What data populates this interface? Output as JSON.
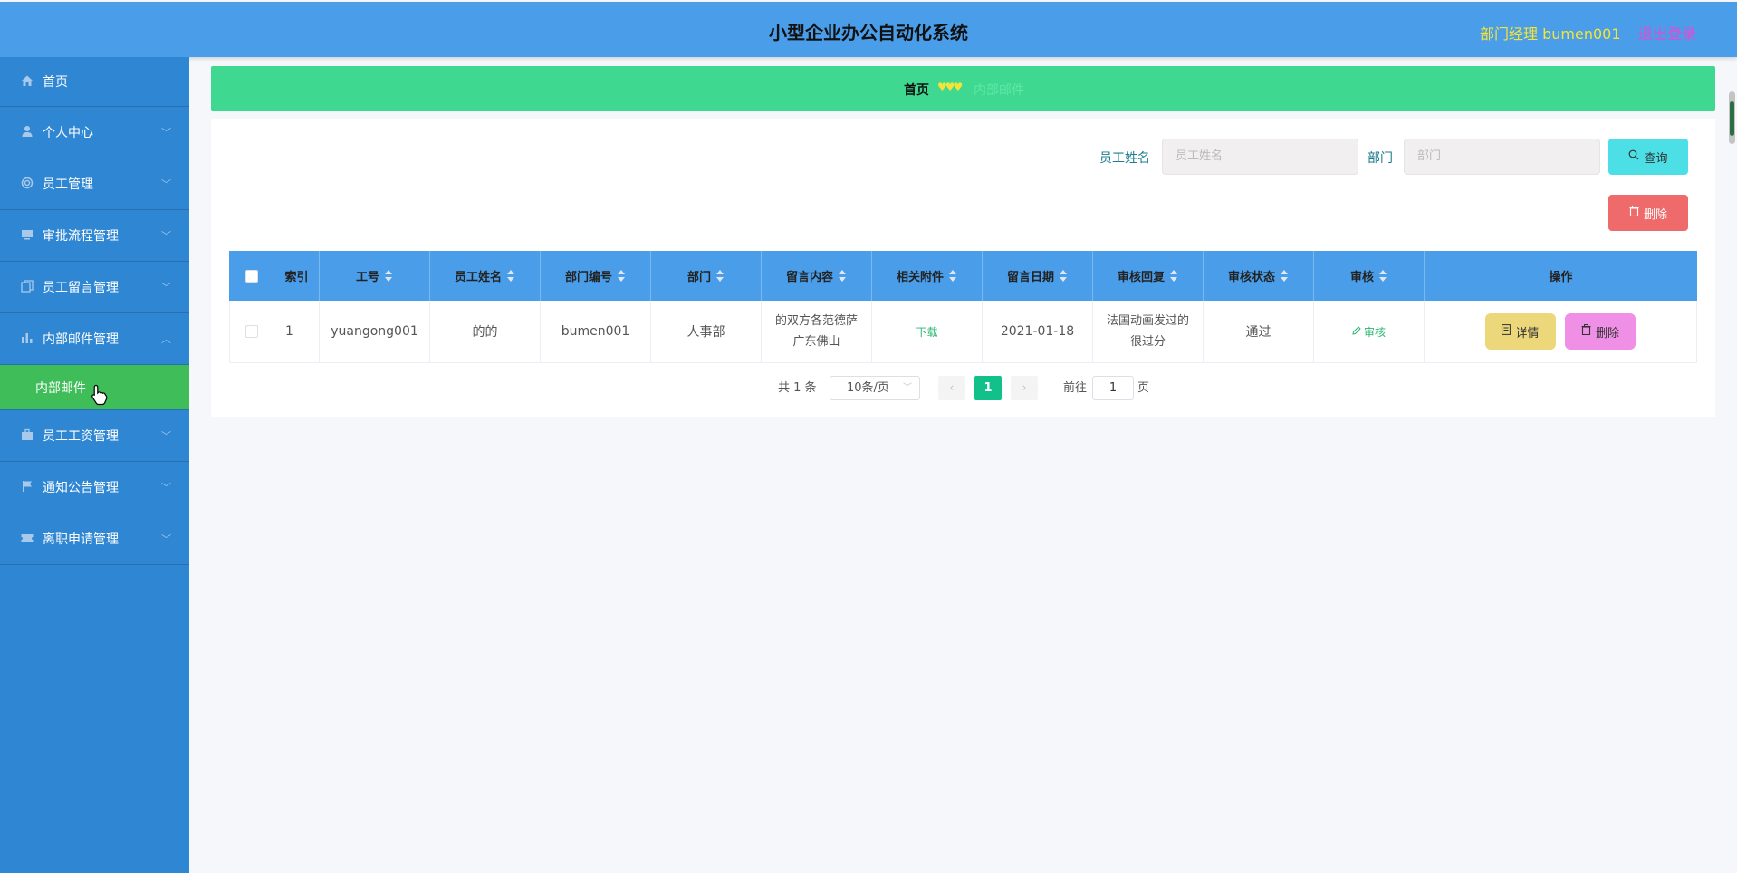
{
  "header": {
    "title": "小型企业办公自动化系统",
    "user": "部门经理 bumen001",
    "logout": "退出登录"
  },
  "sidebar": {
    "items": [
      {
        "label": "首页",
        "icon": "home-icon"
      },
      {
        "label": "个人中心",
        "icon": "user-icon"
      },
      {
        "label": "员工管理",
        "icon": "staff-icon"
      },
      {
        "label": "审批流程管理",
        "icon": "monitor-icon"
      },
      {
        "label": "员工留言管理",
        "icon": "copy-icon"
      },
      {
        "label": "内部邮件管理",
        "icon": "chart-icon"
      },
      {
        "label": "员工工资管理",
        "icon": "briefcase-icon"
      },
      {
        "label": "通知公告管理",
        "icon": "flag-icon"
      },
      {
        "label": "离职申请管理",
        "icon": "ticket-icon"
      }
    ],
    "submenu": {
      "label": "内部邮件"
    }
  },
  "breadcrumb": {
    "home": "首页",
    "separator": "♥♥♥",
    "current": "内部邮件"
  },
  "search": {
    "name_label": "员工姓名",
    "name_placeholder": "员工姓名",
    "dept_label": "部门",
    "dept_placeholder": "部门",
    "query_button": "查询",
    "delete_button": "删除"
  },
  "table": {
    "columns": [
      "索引",
      "工号",
      "员工姓名",
      "部门编号",
      "部门",
      "留言内容",
      "相关附件",
      "留言日期",
      "审核回复",
      "审核状态",
      "审核",
      "操作"
    ],
    "rows": [
      {
        "index": "1",
        "job_no": "yuangong001",
        "name": "的的",
        "dept_no": "bumen001",
        "dept": "人事部",
        "content": "的双方各范德萨广东佛山",
        "attachment": "下载",
        "date": "2021-01-18",
        "reply": "法国动画发过的很过分",
        "status": "通过",
        "audit": "审核",
        "detail_button": "详情",
        "delete_button": "删除"
      }
    ]
  },
  "pagination": {
    "total": "共 1 条",
    "page_size": "10条/页",
    "current_page": "1",
    "goto_label": "前往",
    "goto_value": "1",
    "page_suffix": "页"
  },
  "colors": {
    "header": "#4a9de8",
    "sidebar": "#2f87d3",
    "submenu_active": "#3ebd58",
    "breadcrumb": "#3ed891",
    "table_head": "#4a9de8",
    "query_button": "#4cdfe6",
    "delete_button": "#ef6b6b",
    "detail_button": "#ecd77a",
    "row_delete_button": "#f08fe6",
    "page_active": "#12c18a"
  }
}
